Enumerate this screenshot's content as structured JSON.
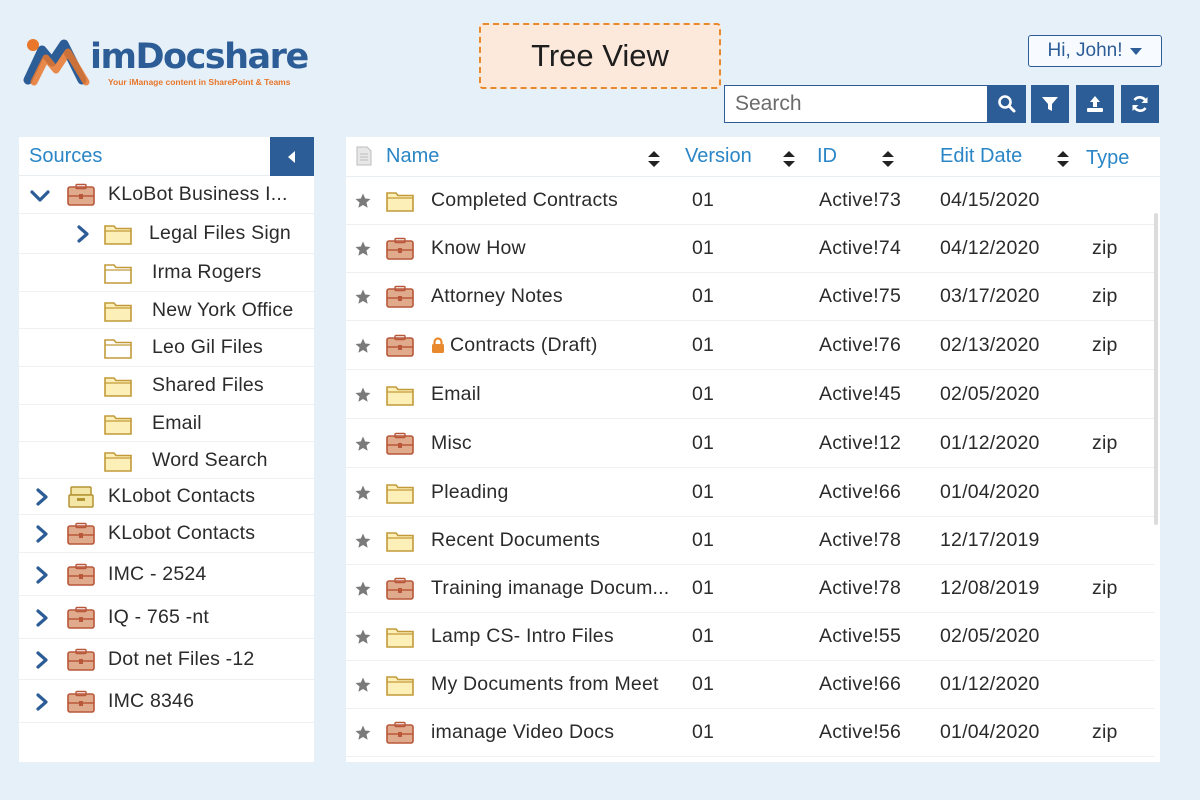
{
  "logo": {
    "wordmark": "imDocshare",
    "tagline": "Your iManage content in SharePoint & Teams"
  },
  "page": {
    "title": "Tree View"
  },
  "user": {
    "greeting": "Hi, John!"
  },
  "search": {
    "placeholder": "Search"
  },
  "sources": {
    "title": "Sources",
    "items": [
      {
        "label": "KLoBot Business I...",
        "icon": "briefcase-icon",
        "chevron": "down",
        "level": 0
      },
      {
        "label": "Legal Files Sign",
        "icon": "folder-icon",
        "chevron": "right",
        "level": 1
      },
      {
        "label": "Irma Rogers",
        "icon": "folder-outline-icon",
        "chevron": "none",
        "level": 1
      },
      {
        "label": "New York Office",
        "icon": "folder-icon",
        "chevron": "none",
        "level": 1
      },
      {
        "label": "Leo Gil Files",
        "icon": "folder-outline-icon",
        "chevron": "none",
        "level": 1
      },
      {
        "label": "Shared Files",
        "icon": "folder-icon",
        "chevron": "none",
        "level": 1
      },
      {
        "label": "Email",
        "icon": "folder-icon",
        "chevron": "none",
        "level": 1
      },
      {
        "label": "Word Search",
        "icon": "folder-icon",
        "chevron": "none",
        "level": 1
      },
      {
        "label": "KLobot Contacts",
        "icon": "archive-box-icon",
        "chevron": "right",
        "level": 0
      },
      {
        "label": "KLobot Contacts",
        "icon": "briefcase-icon",
        "chevron": "right",
        "level": 0
      },
      {
        "label": "IMC - 2524",
        "icon": "briefcase-icon",
        "chevron": "right",
        "level": 0
      },
      {
        "label": "IQ - 765 -nt",
        "icon": "briefcase-icon",
        "chevron": "right",
        "level": 0
      },
      {
        "label": "Dot net Files -12",
        "icon": "briefcase-icon",
        "chevron": "right",
        "level": 0
      },
      {
        "label": "IMC 8346",
        "icon": "briefcase-icon",
        "chevron": "right",
        "level": 0
      }
    ]
  },
  "documents": {
    "columns": {
      "name": "Name",
      "version": "Version",
      "id": "ID",
      "edit_date": "Edit Date",
      "type": "Type"
    },
    "rows": [
      {
        "name": "Completed Contracts",
        "icon": "folder-icon",
        "locked": false,
        "version": "01",
        "id": "Active!73",
        "edit_date": "04/15/2020",
        "type": ""
      },
      {
        "name": "Know How",
        "icon": "briefcase-icon",
        "locked": false,
        "version": "01",
        "id": "Active!74",
        "edit_date": "04/12/2020",
        "type": "zip"
      },
      {
        "name": "Attorney Notes",
        "icon": "briefcase-icon",
        "locked": false,
        "version": "01",
        "id": "Active!75",
        "edit_date": "03/17/2020",
        "type": "zip"
      },
      {
        "name": "Contracts (Draft)",
        "icon": "briefcase-icon",
        "locked": true,
        "version": "01",
        "id": "Active!76",
        "edit_date": "02/13/2020",
        "type": "zip"
      },
      {
        "name": "Email",
        "icon": "folder-icon",
        "locked": false,
        "version": "01",
        "id": "Active!45",
        "edit_date": "02/05/2020",
        "type": ""
      },
      {
        "name": "Misc",
        "icon": "briefcase-icon",
        "locked": false,
        "version": "01",
        "id": "Active!12",
        "edit_date": "01/12/2020",
        "type": "zip"
      },
      {
        "name": "Pleading",
        "icon": "folder-icon",
        "locked": false,
        "version": "01",
        "id": "Active!66",
        "edit_date": "01/04/2020",
        "type": ""
      },
      {
        "name": "Recent Documents",
        "icon": "folder-icon",
        "locked": false,
        "version": "01",
        "id": "Active!78",
        "edit_date": "12/17/2019",
        "type": ""
      },
      {
        "name": "Training imanage Docum...",
        "icon": "briefcase-icon",
        "locked": false,
        "version": "01",
        "id": "Active!78",
        "edit_date": "12/08/2019",
        "type": "zip"
      },
      {
        "name": "Lamp CS- Intro Files",
        "icon": "folder-icon",
        "locked": false,
        "version": "01",
        "id": "Active!55",
        "edit_date": "02/05/2020",
        "type": ""
      },
      {
        "name": "My Documents from Meet",
        "icon": "folder-icon",
        "locked": false,
        "version": "01",
        "id": "Active!66",
        "edit_date": "01/12/2020",
        "type": ""
      },
      {
        "name": "imanage Video Docs",
        "icon": "briefcase-icon",
        "locked": false,
        "version": "01",
        "id": "Active!56",
        "edit_date": "01/04/2020",
        "type": "zip"
      }
    ]
  },
  "colors": {
    "brand_blue": "#2d5d96",
    "link_blue": "#2a86c6",
    "accent_orange": "#e8892e",
    "background": "#e6f0f8"
  }
}
